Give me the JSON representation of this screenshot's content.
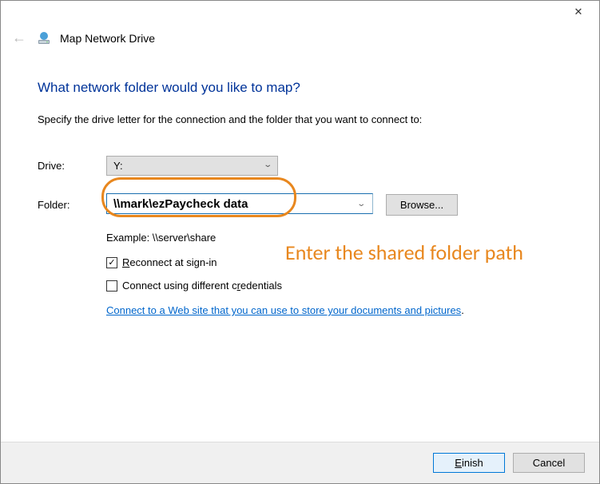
{
  "window": {
    "title": "Map Network Drive"
  },
  "header": {
    "heading": "What network folder would you like to map?",
    "instruction": "Specify the drive letter for the connection and the folder that you want to connect to:"
  },
  "form": {
    "drive_label": "Drive:",
    "drive_value": "Y:",
    "folder_label": "Folder:",
    "folder_value": "\\\\mark\\ezPaycheck data",
    "browse_label": "Browse...",
    "example": "Example: \\\\server\\share",
    "reconnect_label": "Reconnect at sign-in",
    "reconnect_checked": true,
    "diffcred_label": "Connect using different credentials",
    "diffcred_checked": false,
    "link_text": "Connect to a Web site that you can use to store your documents and pictures"
  },
  "annotation": {
    "text": "Enter the shared folder path"
  },
  "footer": {
    "finish_label": "Einish",
    "cancel_label": "Cancel"
  }
}
